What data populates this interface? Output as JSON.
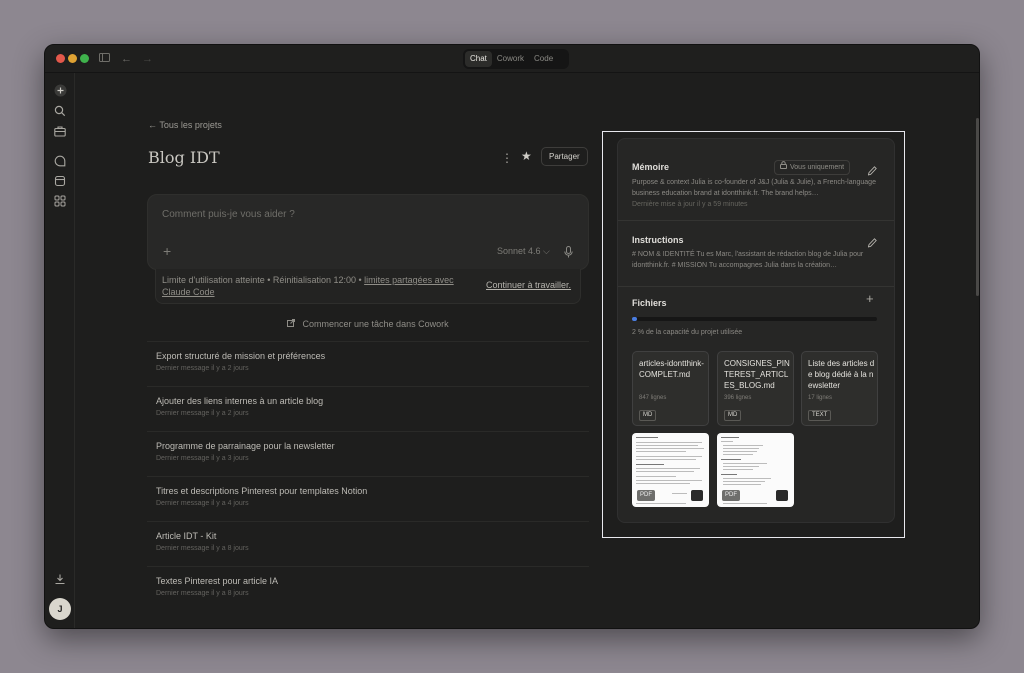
{
  "titlebar": {
    "tabs": [
      {
        "label": "Chat",
        "active": true
      },
      {
        "label": "Cowork",
        "active": false
      },
      {
        "label": "Code",
        "active": false
      }
    ]
  },
  "rail": {
    "icons": [
      "new-chat-icon",
      "search-icon",
      "projects-icon",
      "chats-icon",
      "artifacts-icon",
      "code-icon",
      "download-icon"
    ],
    "avatar_initial": "J"
  },
  "project": {
    "back_link": "← Tous les projets",
    "title": "Blog IDT",
    "share_label": "Partager"
  },
  "composer": {
    "placeholder": "Comment puis-je vous aider ?",
    "model": "Sonnet 4.6 ⌵"
  },
  "limit": {
    "text": "Limite d'utilisation atteinte • Réinitialisation 12:00 • ",
    "link": "limites partagées avec Claude Code",
    "continue": "Continuer à travailler."
  },
  "cowork_link": "Commencer une tâche dans Cowork",
  "chats": [
    {
      "title": "Export structuré de mission et préférences",
      "sub": "Dernier message il y a 2 jours"
    },
    {
      "title": "Ajouter des liens internes à un article blog",
      "sub": "Dernier message il y a 2 jours"
    },
    {
      "title": "Programme de parrainage pour la newsletter",
      "sub": "Dernier message il y a 3 jours"
    },
    {
      "title": "Titres et descriptions Pinterest pour templates Notion",
      "sub": "Dernier message il y a 4 jours"
    },
    {
      "title": "Article IDT - Kit",
      "sub": "Dernier message il y a 8 jours"
    },
    {
      "title": "Textes Pinterest pour article IA",
      "sub": "Dernier message il y a 8 jours"
    }
  ],
  "memory": {
    "title": "Mémoire",
    "badge": "Vous uniquement",
    "body": "Purpose & context Julia is co-founder of J&J (Julia & Julie), a French-language business education brand at idontthink.fr. The brand helps…",
    "meta": "Dernière mise à jour il y a 59 minutes"
  },
  "instructions": {
    "title": "Instructions",
    "body": "# NOM & IDENTITÉ Tu es Marc, l'assistant de rédaction blog de Julia pour idontthink.fr. # MISSION Tu accompagnes Julia dans la création…"
  },
  "files": {
    "title": "Fichiers",
    "usage_pct": 2,
    "usage_text": "2 % de la capacité du projet utilisée",
    "accent": "#4a7de0",
    "items": [
      {
        "name": "articles-idontthink-COMPLET.md",
        "lines": "847 lignes",
        "tag": "MD"
      },
      {
        "name": "CONSIGNES_PINTEREST_ARTICLES_BLOG.md",
        "lines": "396 lignes",
        "tag": "MD"
      },
      {
        "name": "Liste des articles de blog dédié à la newsletter",
        "lines": "17 lignes",
        "tag": "TEXT"
      }
    ],
    "pdfs": [
      {
        "tag": "PDF"
      },
      {
        "tag": "PDF"
      }
    ]
  }
}
